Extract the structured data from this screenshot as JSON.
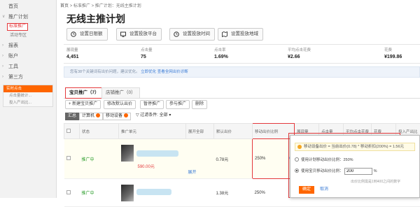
{
  "sidebar": {
    "home": "首页",
    "promo": "推广计划",
    "std": "标准推广",
    "zone": "活动专区",
    "report": "报表",
    "account": "账户",
    "tools": "工具",
    "third": "第三方",
    "rt_head": "实时点击",
    "rt1": "点击量统计...",
    "rt2": "投入产出比..."
  },
  "breadcrumb": {
    "home": "首页",
    "sep1": ">",
    "std": "标准推广",
    "sep2": ">",
    "plan": "推广计划：无线主推计划"
  },
  "title": "无线主推计划",
  "toolbar": [
    "设置日限额",
    "设置投放平台",
    "设置投放时间",
    "设置投放地域"
  ],
  "stats": [
    {
      "label": "展现量",
      "value": "4,451"
    },
    {
      "label": "点击量",
      "value": "75"
    },
    {
      "label": "点击率",
      "value": "1.69%"
    },
    {
      "label": "平均点击花费",
      "value": "¥2.66"
    },
    {
      "label": "花费",
      "value": "¥199.86"
    }
  ],
  "note": {
    "text": "您有38个关键词有出价问题，建议优化。",
    "l1": "立即优化",
    "l2": "查看全网出价诊断"
  },
  "tabs": [
    "宝贝推广（7）",
    "店铺推广（0）"
  ],
  "actions": [
    "+ 新建宝贝推广",
    "修改默认出价",
    "暂停推广",
    "参与推广",
    "删除"
  ],
  "filters": {
    "a": "汇总",
    "b": "计算机",
    "c": "移动设备",
    "sel": "全部"
  },
  "columns": [
    "状态",
    "推广单元",
    "展开全部",
    "默认出价",
    "移动出价比例",
    "展现量",
    "点击量",
    "平均点击花费",
    "花费",
    "投入产出比"
  ],
  "rows": [
    {
      "status": "推广中",
      "price": "590.00元",
      "link": "展开",
      "bid": "0.78元",
      "ratio": "250%"
    },
    {
      "status": "推广中",
      "bid": "1.38元",
      "ratio": "250%"
    }
  ],
  "popup": {
    "formula": "移动设备出价 = 当前出价(0.78) * 移动折扣(200%) = 1.56元",
    "opt1": "使用计划移动出价比例：250%",
    "opt2": "使用宝贝移动出价比例：",
    "value": "200",
    "pct": "%",
    "hint": "出价比例需是1到400之间的数字",
    "ok": "确定",
    "cancel": "取消"
  },
  "colors": {
    "accent": "#e4393c",
    "orange": "#ff6600",
    "green": "#2a9d2a"
  }
}
